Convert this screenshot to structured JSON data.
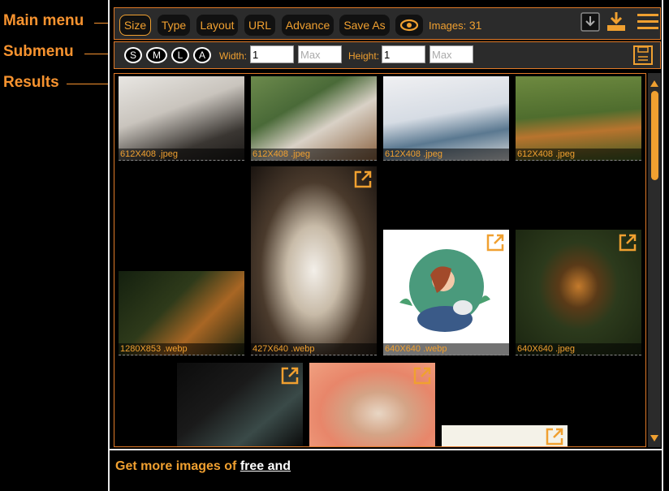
{
  "annotations": {
    "main_menu": "Main menu",
    "submenu": "Submenu",
    "results": "Results"
  },
  "main_menu": {
    "buttons": [
      "Size",
      "Type",
      "Layout",
      "URL",
      "Advance",
      "Save As"
    ],
    "images_label": "Images:",
    "images_count": "31",
    "icons": [
      "eye-icon",
      "download-icon",
      "download-all-icon",
      "hamburger-menu-icon"
    ]
  },
  "submenu": {
    "sizes": [
      "S",
      "M",
      "L",
      "A"
    ],
    "width_label": "Width:",
    "width_min": "1",
    "width_max_placeholder": "Max",
    "height_label": "Height:",
    "height_min": "1",
    "height_max_placeholder": "Max"
  },
  "results": {
    "tiles": [
      {
        "caption": "612X408 .jpeg"
      },
      {
        "caption": "612X408 .jpeg"
      },
      {
        "caption": "612X408 .jpeg"
      },
      {
        "caption": "612X408 .jpeg"
      },
      {
        "caption": "1280X853 .webp"
      },
      {
        "caption": "427X640 .webp"
      },
      {
        "caption": "640X640 .webp"
      },
      {
        "caption": "640X640 .jpeg"
      }
    ]
  },
  "footer": {
    "text": "Get more images of",
    "link": "free and"
  },
  "colors": {
    "accent": "#f0a030",
    "annotation": "#f7932f",
    "panel": "#2b2b2b"
  }
}
